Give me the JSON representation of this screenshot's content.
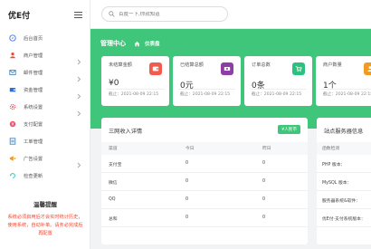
{
  "brand": {
    "name": "优E付"
  },
  "search": {
    "placeholder": "百度一下,你就知道"
  },
  "sidebar": {
    "items": [
      {
        "label": "后台首页",
        "icon": "compass-icon",
        "arrow": false
      },
      {
        "label": "商户管理",
        "icon": "user-icon",
        "arrow": true
      },
      {
        "label": "邮件管理",
        "icon": "mail-icon",
        "arrow": true
      },
      {
        "label": "资金管理",
        "icon": "wallet-icon",
        "arrow": true
      },
      {
        "label": "系统设置",
        "icon": "gear-icon",
        "arrow": true
      },
      {
        "label": "支付配置",
        "icon": "pay-icon",
        "arrow": false
      },
      {
        "label": "工单管理",
        "icon": "ticket-icon",
        "arrow": false
      },
      {
        "label": "广告设置",
        "icon": "ad-icon",
        "arrow": true
      },
      {
        "label": "检查更新",
        "icon": "update-icon",
        "arrow": false
      }
    ]
  },
  "notice": {
    "title": "温馨提醒",
    "text": "系统必须启用后才会实时统计历史，使用系统，自动补单。请务必完成后再配置"
  },
  "breadcrumb": {
    "title": "管理中心",
    "current": "仪表盘"
  },
  "cards": [
    {
      "label": "未结算金额",
      "value": "¥0",
      "foot": "截止：2021-08-09 22:15",
      "color": "#f15b4e",
      "icon": "wallet-icon"
    },
    {
      "label": "已结算总额",
      "value": "0元",
      "foot": "截止：2021-08-09 22:15",
      "color": "#8e3ea4",
      "icon": "money-icon"
    },
    {
      "label": "订单总数",
      "value": "0条",
      "foot": "截止：2021-08-09 22:15",
      "color": "#2bc17e",
      "icon": "cart-icon"
    },
    {
      "label": "商户数量",
      "value": "1个",
      "foot": "截止：2021-08-09 22:15",
      "color": "#f39a20",
      "icon": "users-icon"
    }
  ],
  "income": {
    "title": "三网收入详情",
    "tag": "¥人民币",
    "headers": [
      "渠道",
      "今日",
      "昨日"
    ],
    "rows": [
      [
        "支付宝",
        "0",
        "0"
      ],
      [
        "微信",
        "0",
        "0"
      ],
      [
        "QQ",
        "0",
        "0"
      ],
      [
        "总和",
        "0",
        "0"
      ]
    ]
  },
  "server": {
    "title": "站点服务器信息",
    "head": "函数检测",
    "rows": [
      "PHP 版本：",
      "MySQL 版本：",
      "服务器系统&软件：",
      "优E付·支付系统版本："
    ]
  },
  "colors": {
    "accent": "#3fc67a",
    "alert": "#f0482f"
  }
}
